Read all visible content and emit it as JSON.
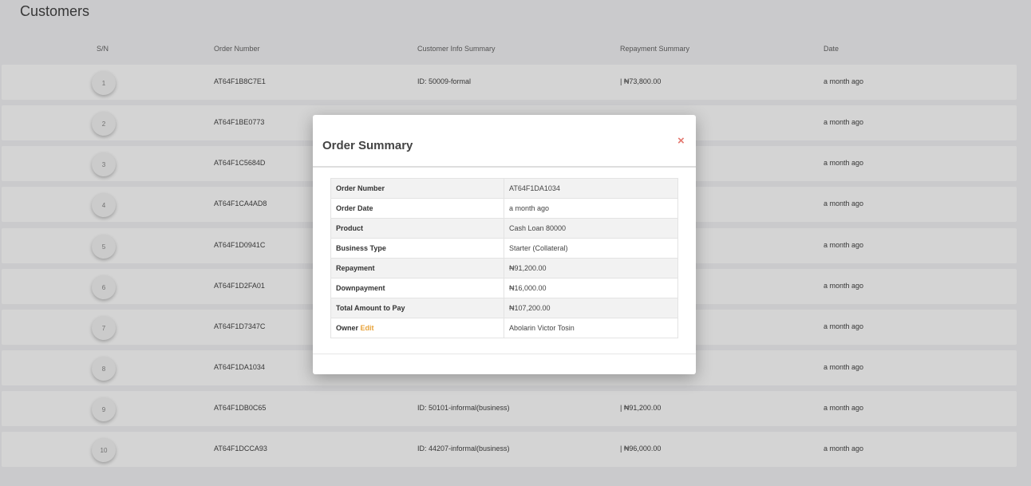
{
  "page": {
    "title": "Customers"
  },
  "table": {
    "headers": [
      "S/N",
      "Order Number",
      "Customer Info Summary",
      "Repayment Summary",
      "Date"
    ],
    "rows": [
      {
        "sn": "1",
        "order": "AT64F1B8C7E1",
        "info": "ID: 50009-formal",
        "repay": "| ₦73,800.00",
        "date": "a month ago"
      },
      {
        "sn": "2",
        "order": "AT64F1BE0773",
        "info": "",
        "repay": "",
        "date": "a month ago"
      },
      {
        "sn": "3",
        "order": "AT64F1C5684D",
        "info": "",
        "repay": "",
        "date": "a month ago"
      },
      {
        "sn": "4",
        "order": "AT64F1CA4AD8",
        "info": "",
        "repay": "",
        "date": "a month ago"
      },
      {
        "sn": "5",
        "order": "AT64F1D0941C",
        "info": "",
        "repay": "",
        "date": "a month ago"
      },
      {
        "sn": "6",
        "order": "AT64F1D2FA01",
        "info": "",
        "repay": "",
        "date": "a month ago"
      },
      {
        "sn": "7",
        "order": "AT64F1D7347C",
        "info": "",
        "repay": "",
        "date": "a month ago"
      },
      {
        "sn": "8",
        "order": "AT64F1DA1034",
        "info": "",
        "repay": "",
        "date": "a month ago"
      },
      {
        "sn": "9",
        "order": "AT64F1DB0C65",
        "info": "ID: 50101-informal(business)",
        "repay": "| ₦91,200.00",
        "date": "a month ago"
      },
      {
        "sn": "10",
        "order": "AT64F1DCCA93",
        "info": "ID: 44207-informal(business)",
        "repay": "| ₦96,000.00",
        "date": "a month ago"
      }
    ]
  },
  "modal": {
    "title": "Order Summary",
    "close_glyph": "×",
    "rows": [
      {
        "label": "Order Number",
        "value": "AT64F1DA1034"
      },
      {
        "label": "Order Date",
        "value": "a month ago"
      },
      {
        "label": "Product",
        "value": "Cash Loan 80000"
      },
      {
        "label": "Business Type",
        "value": "Starter (Collateral)"
      },
      {
        "label": "Repayment",
        "value": "₦91,200.00"
      },
      {
        "label": "Downpayment",
        "value": "₦16,000.00"
      },
      {
        "label": "Total Amount to Pay",
        "value": "₦107,200.00"
      }
    ],
    "owner": {
      "label": "Owner",
      "edit_label": "Edit",
      "value": "Abolarin Victor Tosin"
    }
  },
  "colors": {
    "accent_edit": "#e8a33a",
    "close": "#e4776e",
    "overlay": "rgba(0,0,0,0.17)"
  }
}
